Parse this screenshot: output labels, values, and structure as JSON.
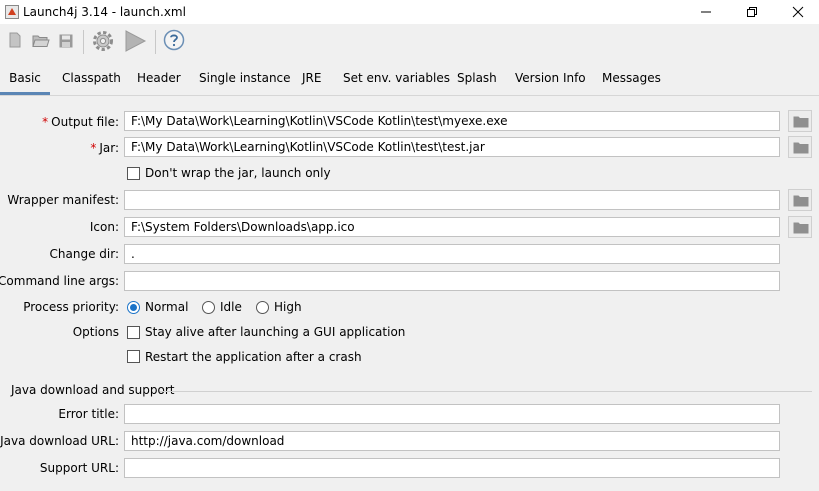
{
  "window": {
    "title": "Launch4j 3.14 - launch.xml"
  },
  "toolbar": {
    "icons": [
      "new-file-icon",
      "open-folder-icon",
      "save-icon",
      "build-gear-icon",
      "run-icon",
      "help-icon"
    ]
  },
  "tabs": [
    {
      "label": "Basic",
      "active": true
    },
    {
      "label": "Classpath"
    },
    {
      "label": "Header"
    },
    {
      "label": "Single instance"
    },
    {
      "label": "JRE"
    },
    {
      "label": "Set env. variables"
    },
    {
      "label": "Splash"
    },
    {
      "label": "Version Info"
    },
    {
      "label": "Messages"
    }
  ],
  "basic": {
    "required_marker": "*",
    "output_file": {
      "label": "Output file:",
      "value": "F:\\My Data\\Work\\Learning\\Kotlin\\VSCode Kotlin\\test\\myexe.exe"
    },
    "jar": {
      "label": "Jar:",
      "value": "F:\\My Data\\Work\\Learning\\Kotlin\\VSCode Kotlin\\test\\test.jar"
    },
    "dont_wrap": {
      "label": "Don't wrap the jar, launch only",
      "checked": false
    },
    "wrapper_manifest": {
      "label": "Wrapper manifest:",
      "value": ""
    },
    "icon": {
      "label": "Icon:",
      "value": "F:\\System Folders\\Downloads\\app.ico"
    },
    "change_dir": {
      "label": "Change dir:",
      "value": "."
    },
    "cmd_args": {
      "label": "Command line args:",
      "value": ""
    },
    "priority": {
      "label": "Process priority:",
      "options": [
        "Normal",
        "Idle",
        "High"
      ],
      "selected": "Normal"
    },
    "options": {
      "label": "Options",
      "stay_alive": "Stay alive after launching a GUI application",
      "restart": "Restart the application after a crash"
    }
  },
  "java_download": {
    "section_title": "Java download and support",
    "error_title": {
      "label": "Error title:",
      "value": ""
    },
    "download_url": {
      "label": "Java download URL:",
      "value": "http://java.com/download"
    },
    "support_url": {
      "label": "Support URL:",
      "value": ""
    }
  },
  "colors": {
    "accent": "#5b86b5",
    "radio": "#1a73c8",
    "required": "#d00000"
  }
}
